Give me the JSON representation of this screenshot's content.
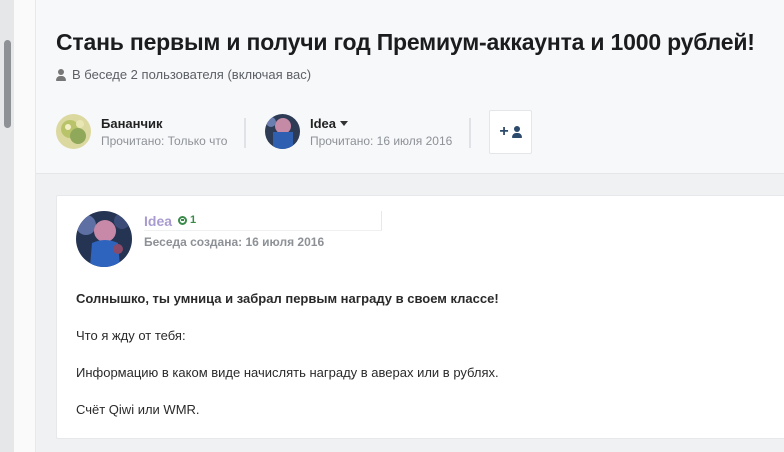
{
  "header": {
    "title": "Стань первым и получи год Премиум-аккаунта и 1000 рублей!",
    "meta": "В беседе 2 пользователя (включая вас)"
  },
  "participants": [
    {
      "name": "Бананчик",
      "status": "Прочитано: Только что"
    },
    {
      "name": "Idea",
      "status": "Прочитано: 16 июля 2016"
    }
  ],
  "add_participant": {
    "plus": "+"
  },
  "post": {
    "author": "Idea",
    "reputation": "1",
    "created": "Беседа создана: 16 июля 2016",
    "paragraphs": [
      "Солнышко, ты умница и забрал первым награду в своем классе!",
      "Что я жду от тебя:",
      "Информацию в каком виде начислять награду в аверах или в рублях.",
      "Счёт Qiwi или WMR."
    ]
  },
  "colors": {
    "author_name": "#a99bd0",
    "reputation": "#3a8a4a",
    "add_icon": "#2c4a6b"
  },
  "icons": [
    "user-icon",
    "caret-down-icon",
    "plus-icon",
    "person-icon",
    "reputation-icon"
  ]
}
